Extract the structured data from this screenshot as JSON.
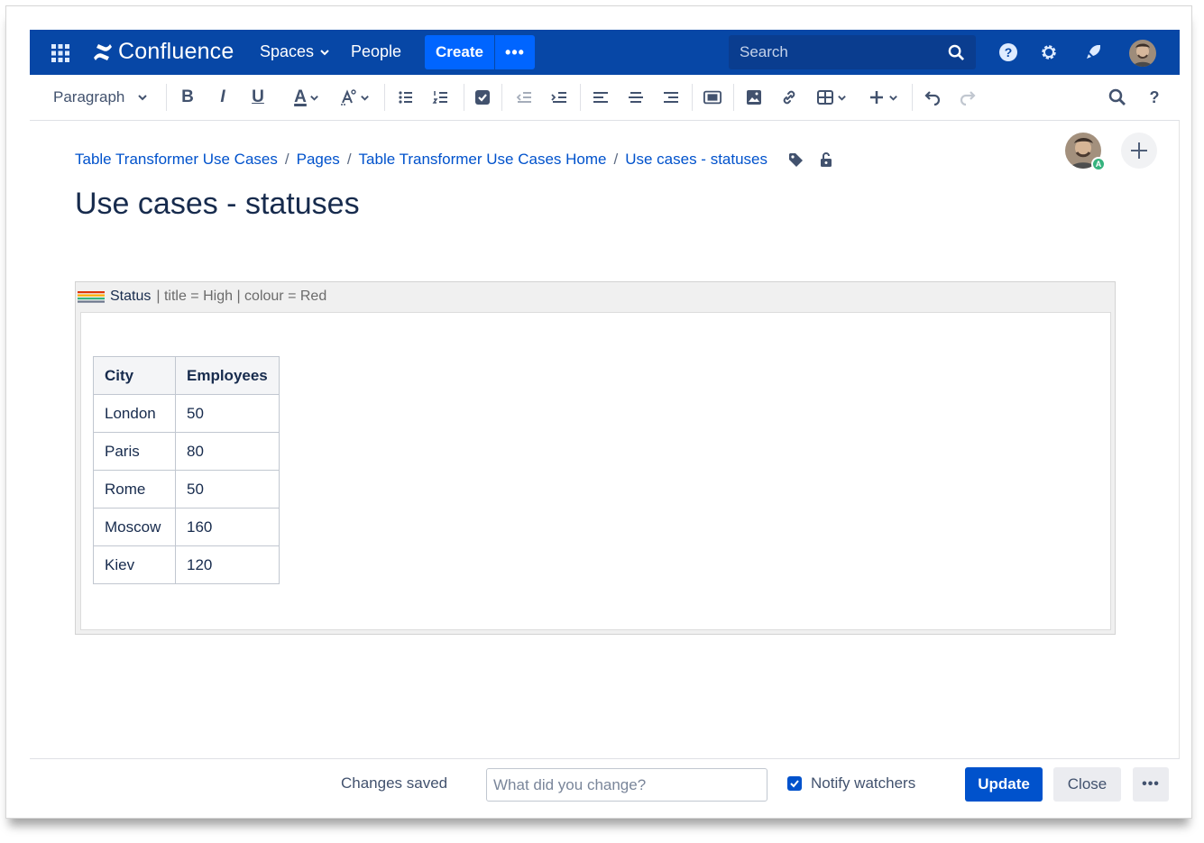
{
  "nav": {
    "logo": "Confluence",
    "spaces": "Spaces",
    "people": "People",
    "create": "Create",
    "more": "•••",
    "search_placeholder": "Search"
  },
  "toolbar": {
    "paragraph": "Paragraph",
    "bold": "B",
    "italic": "I",
    "underline": "U",
    "text_color": "A"
  },
  "breadcrumb": {
    "items": [
      "Table Transformer Use Cases",
      "Pages",
      "Table Transformer Use Cases Home",
      "Use cases - statuses"
    ],
    "separator": "/"
  },
  "page": {
    "title": "Use cases - statuses",
    "avatar_badge": "A"
  },
  "macro": {
    "name": "Status",
    "params": "| title = High | colour = Red",
    "colors": [
      "#de350b",
      "#ffab00",
      "#36b37e",
      "#6b778c"
    ]
  },
  "table": {
    "headers": [
      "City",
      "Employees"
    ],
    "rows": [
      [
        "London",
        "50"
      ],
      [
        "Paris",
        "80"
      ],
      [
        "Rome",
        "50"
      ],
      [
        "Moscow",
        "160"
      ],
      [
        "Kiev",
        "120"
      ]
    ]
  },
  "footer": {
    "status": "Changes saved",
    "change_placeholder": "What did you change?",
    "notify": "Notify watchers",
    "notify_checked": true,
    "update": "Update",
    "close": "Close",
    "more": "•••"
  },
  "colors": {
    "nav_bg": "#0747a6",
    "create_bg": "#0065ff",
    "primary": "#0052cc",
    "link": "#0052cc"
  }
}
